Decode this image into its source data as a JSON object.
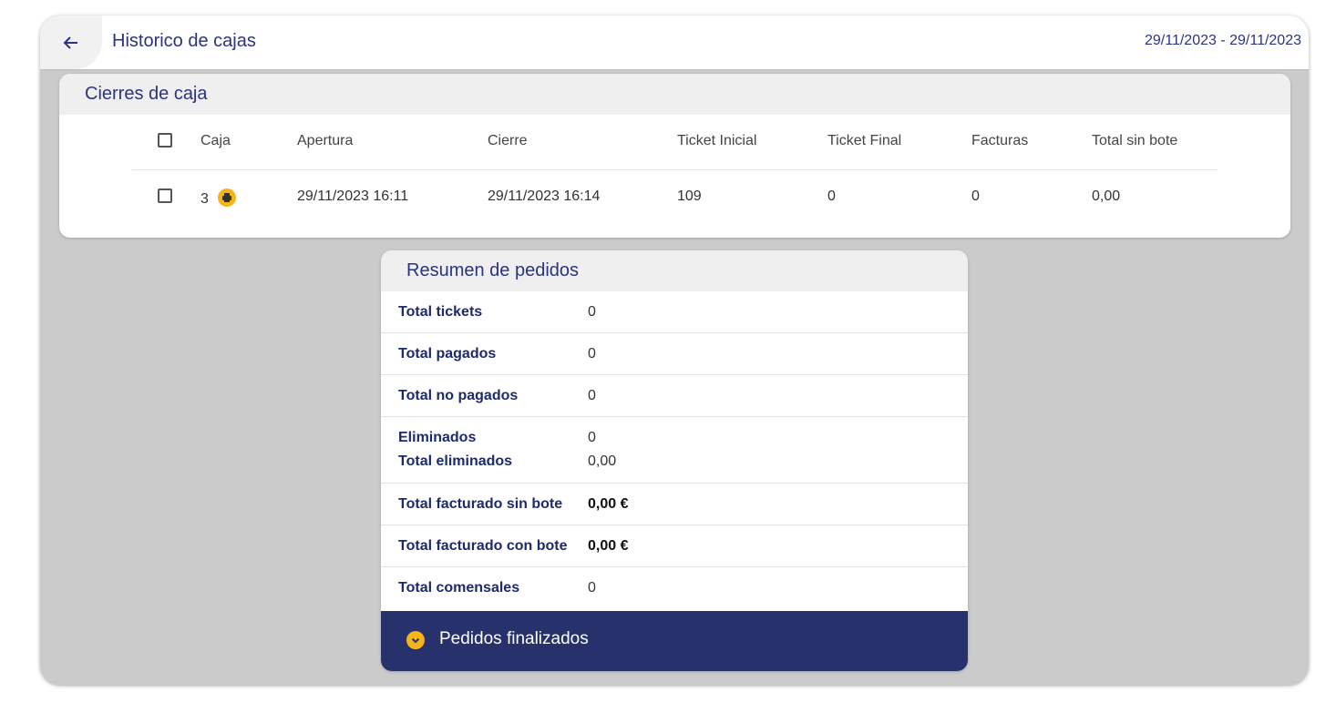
{
  "header": {
    "back_icon": "arrow-left-icon",
    "title": "Historico de cajas",
    "date_range": "29/11/2023 - 29/11/2023"
  },
  "cierres": {
    "title": "Cierres de caja",
    "columns": [
      "Caja",
      "Apertura",
      "Cierre",
      "Ticket Inicial",
      "Ticket Final",
      "Facturas",
      "Total sin bote"
    ],
    "rows": [
      {
        "caja": "3",
        "apertura": "29/11/2023 16:11",
        "cierre": "29/11/2023 16:14",
        "ticket_inicial": "109",
        "ticket_final": "0",
        "facturas": "0",
        "total_sin_bote": "0,00",
        "icon": "printer-icon"
      }
    ]
  },
  "resumen": {
    "title": "Resumen de pedidos",
    "total_tickets_label": "Total tickets",
    "total_tickets_value": "0",
    "total_pagados_label": "Total pagados",
    "total_pagados_value": "0",
    "total_no_pagados_label": "Total no pagados",
    "total_no_pagados_value": "0",
    "eliminados_label": "Eliminados",
    "eliminados_value": "0",
    "total_eliminados_label": "Total eliminados",
    "total_eliminados_value": "0,00",
    "total_facturado_sin_bote_label": "Total facturado sin bote",
    "total_facturado_sin_bote_value": "0,00 €",
    "total_facturado_con_bote_label": "Total facturado con bote",
    "total_facturado_con_bote_value": "0,00 €",
    "total_comensales_label": "Total comensales",
    "total_comensales_value": "0"
  },
  "footer": {
    "label": "Pedidos finalizados",
    "icon": "chevron-down-circle-icon"
  },
  "colors": {
    "primary": "#2a3480",
    "footer_bg": "#27316c",
    "accent": "#f5b31c",
    "background": "#cbcbcb"
  }
}
